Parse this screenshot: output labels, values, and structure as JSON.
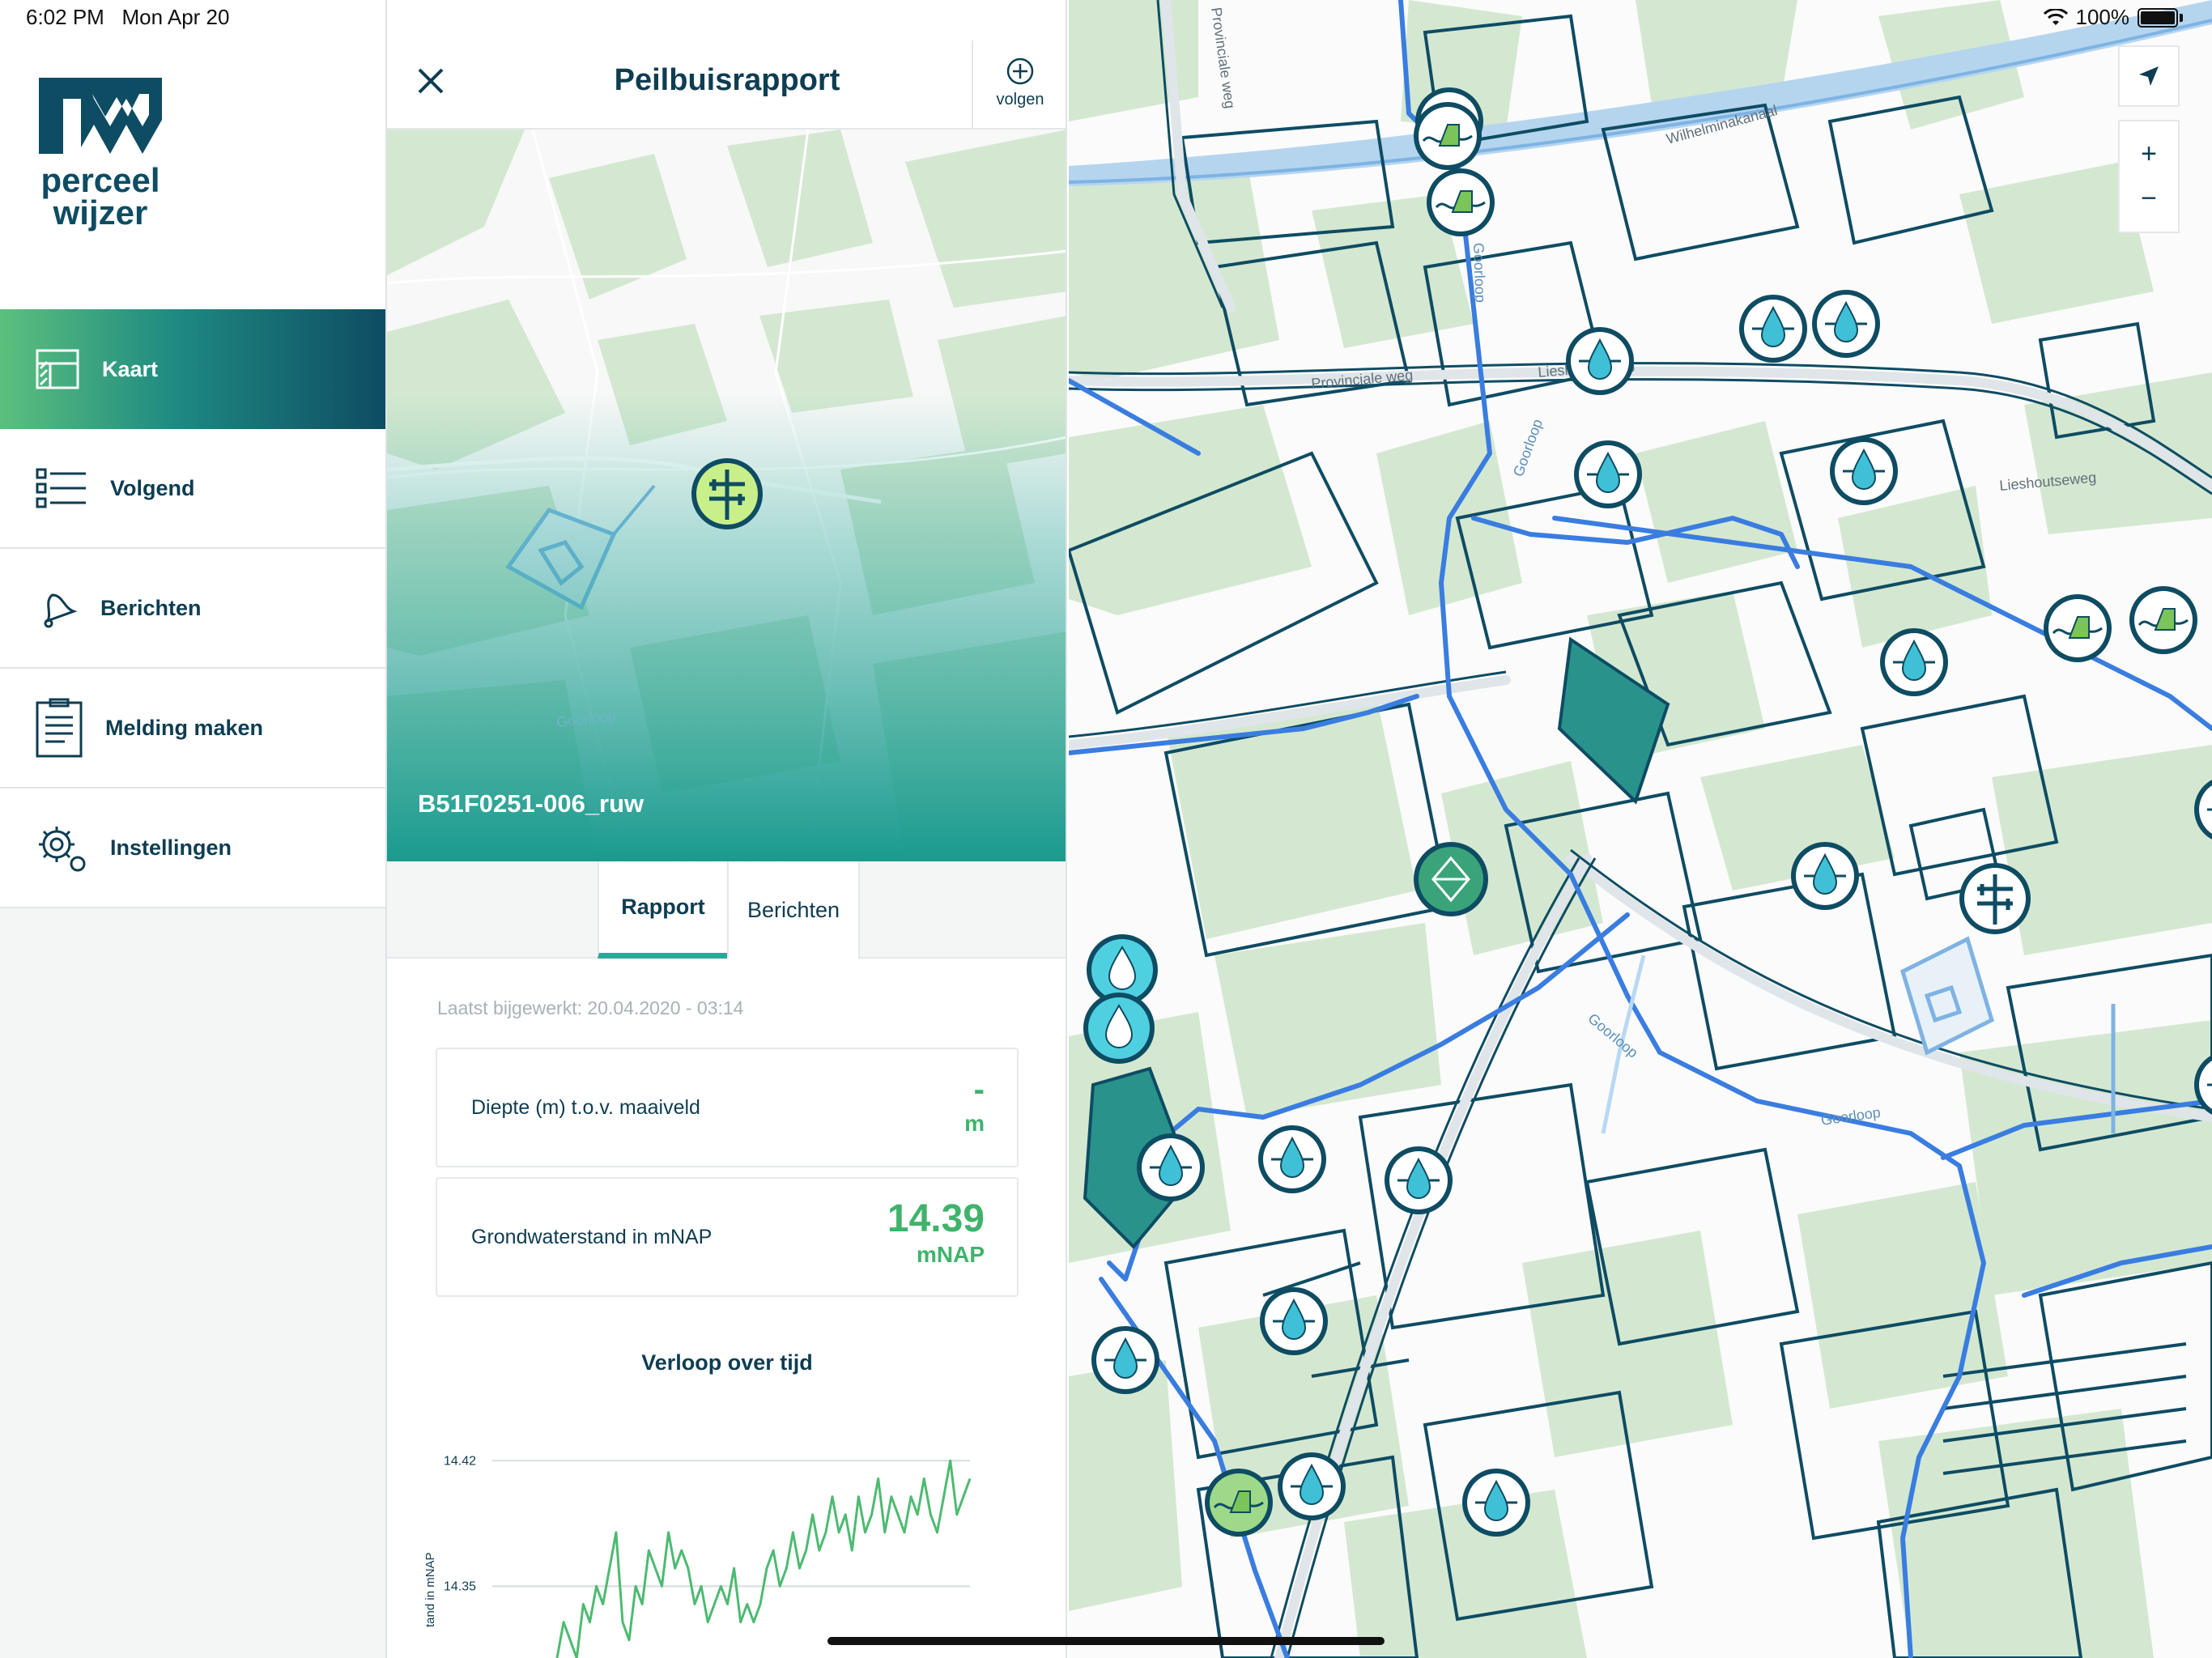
{
  "status_bar": {
    "time": "6:02 PM",
    "date": "Mon Apr 20",
    "battery": "100%"
  },
  "sidebar": {
    "logo": {
      "line1": "perceel",
      "line2": "wijzer"
    },
    "items": [
      {
        "label": "Kaart",
        "icon": "map-icon",
        "active": true
      },
      {
        "label": "Volgend",
        "icon": "list-icon",
        "active": false
      },
      {
        "label": "Berichten",
        "icon": "bell-icon",
        "active": false
      },
      {
        "label": "Melding maken",
        "icon": "clipboard-icon",
        "active": false
      },
      {
        "label": "Instellingen",
        "icon": "gear-icon",
        "active": false
      }
    ]
  },
  "panel": {
    "title": "Peilbuisrapport",
    "follow_label": "volgen",
    "well_id": "B51F0251-006_ruw",
    "map_label": "Goorloop",
    "tabs": [
      {
        "label": "Rapport",
        "active": true
      },
      {
        "label": "Berichten",
        "active": false
      }
    ],
    "last_updated": "Laatst bijgewerkt: 20.04.2020 - 03:14",
    "cards": [
      {
        "label": "Diepte (m) t.o.v. maaiveld",
        "value": "-",
        "unit": "m"
      },
      {
        "label": "Grondwaterstand in mNAP",
        "value": "14.39",
        "unit": "mNAP"
      }
    ],
    "chart_title": "Verloop over tijd"
  },
  "chart_data": {
    "type": "line",
    "title": "Verloop over tijd",
    "ylabel": "tand in mNAP",
    "y_ticks": [
      14.42,
      14.35
    ],
    "ylim": [
      14.31,
      14.44
    ],
    "series": [
      {
        "values": [
          14.31,
          14.33,
          14.32,
          14.31,
          14.34,
          14.33,
          14.35,
          14.34,
          14.36,
          14.38,
          14.33,
          14.32,
          14.35,
          14.34,
          14.37,
          14.36,
          14.35,
          14.38,
          14.36,
          14.37,
          14.36,
          14.34,
          14.35,
          14.33,
          14.34,
          14.35,
          14.34,
          14.36,
          14.33,
          14.34,
          14.33,
          14.34,
          14.36,
          14.37,
          14.35,
          14.36,
          14.38,
          14.36,
          14.37,
          14.39,
          14.37,
          14.38,
          14.4,
          14.38,
          14.39,
          14.37,
          14.4,
          14.38,
          14.39,
          14.41,
          14.38,
          14.4,
          14.39,
          14.38,
          14.4,
          14.39,
          14.41,
          14.39,
          14.38,
          14.4,
          14.42,
          14.39,
          14.4,
          14.41
        ]
      }
    ],
    "line_color": "#4dba70"
  },
  "main_map": {
    "labels": [
      "Wilhelminakanaal",
      "Provinciale weg",
      "Provinciale weg",
      "Lieshoutseweg",
      "Goorloop",
      "Goorloop",
      "Goorloop",
      "Goorloop",
      "Lieshoutseweg"
    ]
  },
  "map_controls": {
    "zoom_in": "+",
    "zoom_out": "−"
  },
  "colors": {
    "brand": "#0e4c63",
    "accent": "#2aa89b",
    "value_green": "#3fb36c",
    "water": "#3a7de0",
    "field": "#d4e8d1"
  }
}
